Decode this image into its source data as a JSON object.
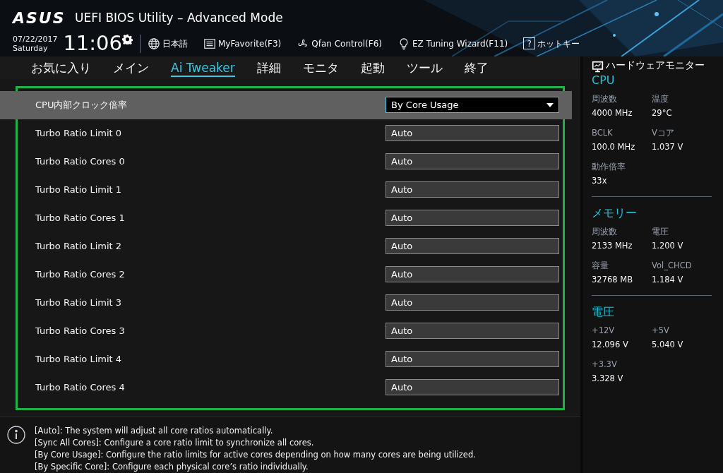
{
  "header": {
    "logo": "ASUS",
    "title": "UEFI BIOS Utility – Advanced Mode",
    "date": "07/22/2017",
    "day": "Saturday",
    "time": "11:06",
    "tools": [
      {
        "kind": "globe",
        "label": "日本語"
      },
      {
        "kind": "list",
        "label": "MyFavorite(F3)"
      },
      {
        "kind": "fan",
        "label": "Qfan Control(F6)"
      },
      {
        "kind": "bulb",
        "label": "EZ Tuning Wizard(F11)"
      },
      {
        "kind": "help",
        "icon_text": "?",
        "label": "ホットキー"
      }
    ]
  },
  "tabs": [
    {
      "label": "お気に入り",
      "selected": false
    },
    {
      "label": "メイン",
      "selected": false
    },
    {
      "label": "Ai Tweaker",
      "selected": true
    },
    {
      "label": "詳細",
      "selected": false
    },
    {
      "label": "モニタ",
      "selected": false
    },
    {
      "label": "起動",
      "selected": false
    },
    {
      "label": "ツール",
      "selected": false
    },
    {
      "label": "終了",
      "selected": false
    }
  ],
  "settings": [
    {
      "label": "CPU内部クロック倍率",
      "value": "By Core Usage",
      "kind": "dropdown",
      "selected": true
    },
    {
      "label": "Turbo Ratio Limit 0",
      "value": "Auto",
      "kind": "field",
      "selected": false
    },
    {
      "label": "Turbo Ratio Cores 0",
      "value": "Auto",
      "kind": "field",
      "selected": false
    },
    {
      "label": "Turbo Ratio Limit 1",
      "value": "Auto",
      "kind": "field",
      "selected": false
    },
    {
      "label": "Turbo Ratio Cores 1",
      "value": "Auto",
      "kind": "field",
      "selected": false
    },
    {
      "label": "Turbo Ratio Limit 2",
      "value": "Auto",
      "kind": "field",
      "selected": false
    },
    {
      "label": "Turbo Ratio Cores 2",
      "value": "Auto",
      "kind": "field",
      "selected": false
    },
    {
      "label": "Turbo Ratio Limit 3",
      "value": "Auto",
      "kind": "field",
      "selected": false
    },
    {
      "label": "Turbo Ratio Cores 3",
      "value": "Auto",
      "kind": "field",
      "selected": false
    },
    {
      "label": "Turbo Ratio Limit 4",
      "value": "Auto",
      "kind": "field",
      "selected": false
    },
    {
      "label": "Turbo Ratio Cores 4",
      "value": "Auto",
      "kind": "field",
      "selected": false
    }
  ],
  "help": [
    "[Auto]: The system will adjust all core ratios automatically.",
    "[Sync All Cores]: Configure a core ratio limit to synchronize all cores.",
    "[By Core Usage]: Configure the ratio limits for active cores depending on how many cores are being utilized.",
    "[By Specific Core]: Configure each physical core’s ratio individually."
  ],
  "hardware_monitor": {
    "title": "ハードウェアモニター",
    "sections": [
      {
        "title": "CPU",
        "items": [
          {
            "label": "周波数",
            "value": "4000 MHz"
          },
          {
            "label": "温度",
            "value": "29°C"
          },
          {
            "label": "BCLK",
            "value": "100.0 MHz"
          },
          {
            "label": "Vコア",
            "value": "1.037 V"
          },
          {
            "label": "動作倍率",
            "value": "33x"
          }
        ]
      },
      {
        "title": "メモリー",
        "items": [
          {
            "label": "周波数",
            "value": "2133 MHz"
          },
          {
            "label": "電圧",
            "value": "1.200 V"
          },
          {
            "label": "容量",
            "value": "32768 MB"
          },
          {
            "label": "Vol_CHCD",
            "value": "1.184 V"
          }
        ]
      },
      {
        "title": "電圧",
        "items": [
          {
            "label": "+12V",
            "value": "12.096 V"
          },
          {
            "label": "+5V",
            "value": "5.040 V"
          },
          {
            "label": "+3.3V",
            "value": "3.328 V"
          }
        ]
      }
    ]
  }
}
